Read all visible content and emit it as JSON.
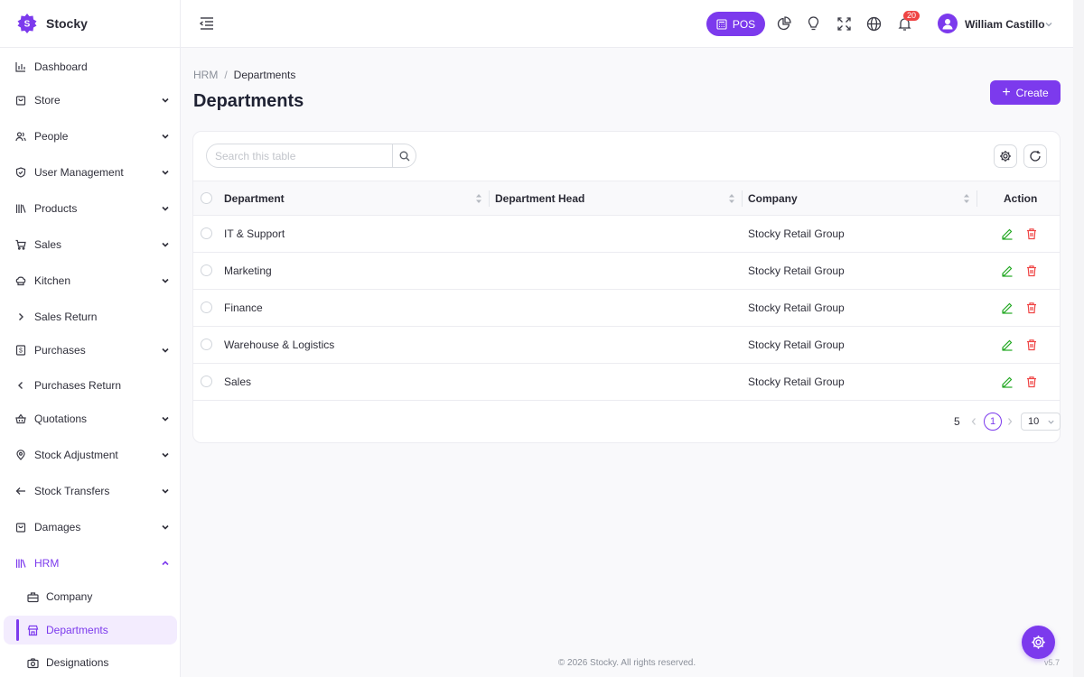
{
  "brand": {
    "name": "Stocky",
    "logo_letter": "S"
  },
  "sidebar": {
    "items": [
      {
        "label": "Dashboard",
        "icon": "bar-chart-icon",
        "expandable": false
      },
      {
        "label": "Store",
        "icon": "store-bag-icon",
        "expandable": true
      },
      {
        "label": "People",
        "icon": "users-icon",
        "expandable": true
      },
      {
        "label": "User Management",
        "icon": "shield-check-icon",
        "expandable": true
      },
      {
        "label": "Products",
        "icon": "books-icon",
        "expandable": true
      },
      {
        "label": "Sales",
        "icon": "cart-icon",
        "expandable": true
      },
      {
        "label": "Kitchen",
        "icon": "chef-hat-icon",
        "expandable": true
      },
      {
        "label": "Sales Return",
        "icon": "chevron-right-icon",
        "expandable": false
      },
      {
        "label": "Purchases",
        "icon": "receipt-icon",
        "expandable": true
      },
      {
        "label": "Purchases Return",
        "icon": "chevron-left-icon",
        "expandable": false
      },
      {
        "label": "Quotations",
        "icon": "basket-icon",
        "expandable": true
      },
      {
        "label": "Stock Adjustment",
        "icon": "map-pin-icon",
        "expandable": true
      },
      {
        "label": "Stock Transfers",
        "icon": "arrow-left-icon",
        "expandable": true
      },
      {
        "label": "Damages",
        "icon": "box-bag-icon",
        "expandable": true
      },
      {
        "label": "HRM",
        "icon": "library-icon",
        "expandable": true,
        "expanded": true
      }
    ],
    "hrm_children": [
      {
        "label": "Company",
        "icon": "building-icon"
      },
      {
        "label": "Departments",
        "icon": "store-icon",
        "active": true
      },
      {
        "label": "Designations",
        "icon": "camera-icon"
      }
    ]
  },
  "topbar": {
    "pos_label": "POS",
    "notification_count": "20",
    "user_name": "William Castillo"
  },
  "breadcrumb": {
    "parent": "HRM",
    "separator": "/",
    "current": "Departments"
  },
  "page": {
    "title": "Departments",
    "create_label": "Create"
  },
  "table": {
    "search_placeholder": "Search this table",
    "columns": [
      "Department",
      "Department Head",
      "Company",
      "Action"
    ],
    "rows": [
      {
        "department": "IT & Support",
        "head": "",
        "company": "Stocky Retail Group"
      },
      {
        "department": "Marketing",
        "head": "",
        "company": "Stocky Retail Group"
      },
      {
        "department": "Finance",
        "head": "",
        "company": "Stocky Retail Group"
      },
      {
        "department": "Warehouse & Logistics",
        "head": "",
        "company": "Stocky Retail Group"
      },
      {
        "department": "Sales",
        "head": "",
        "company": "Stocky Retail Group"
      }
    ],
    "pagination": {
      "total": "5",
      "current_page": "1",
      "page_size": "10"
    }
  },
  "footer": {
    "copyright": "© 2026 Stocky. All rights reserved.",
    "version": "v5.7"
  },
  "colors": {
    "accent": "#7c3aed",
    "danger": "#ef4444",
    "edit": "#22a822"
  }
}
